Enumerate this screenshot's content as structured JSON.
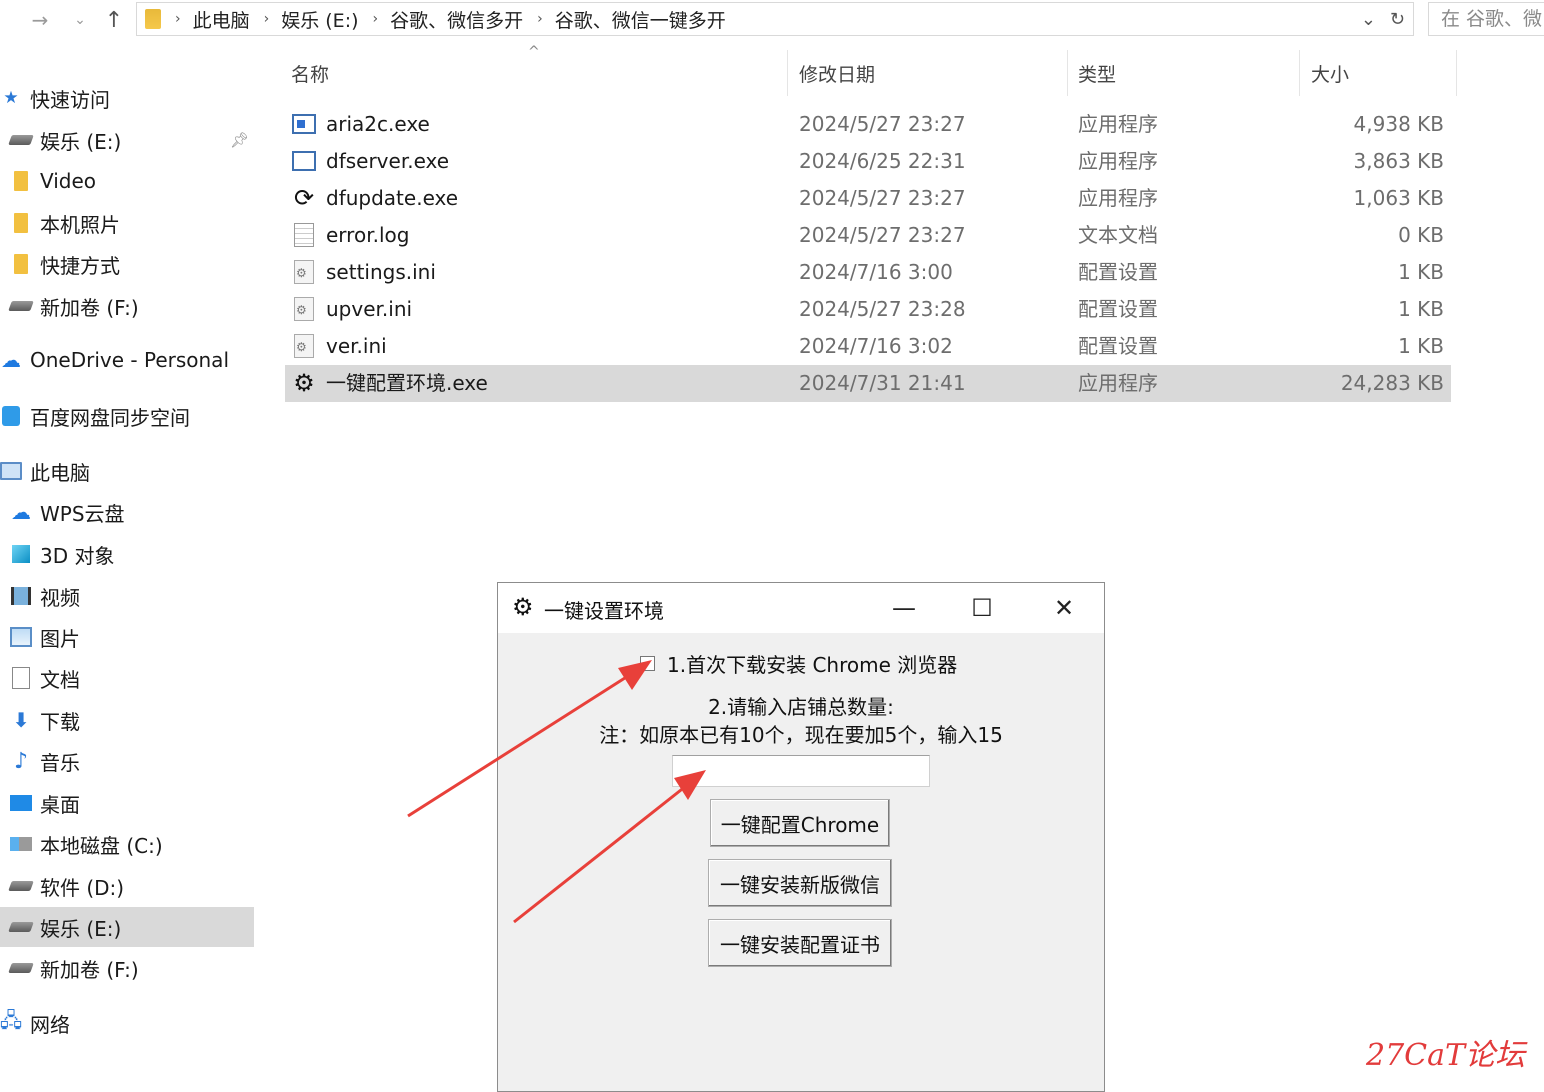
{
  "addressbar": {
    "crumbs": [
      "此电脑",
      "娱乐 (E:)",
      "谷歌、微信多开",
      "谷歌、微信一键多开"
    ],
    "search_placeholder": "在 谷歌、微"
  },
  "sidebar": {
    "items": [
      {
        "label": "快速访问",
        "icon": "star-icon"
      },
      {
        "label": "娱乐 (E:)",
        "icon": "drive-icon"
      },
      {
        "label": "Video",
        "icon": "folder-icon"
      },
      {
        "label": "本机照片",
        "icon": "folder-icon"
      },
      {
        "label": "快捷方式",
        "icon": "folder-icon"
      },
      {
        "label": "新加卷 (F:)",
        "icon": "drive-icon"
      },
      {
        "label": "OneDrive - Personal",
        "icon": "cloud-icon"
      },
      {
        "label": "百度网盘同步空间",
        "icon": "baidu-icon"
      },
      {
        "label": "此电脑",
        "icon": "pc-icon"
      },
      {
        "label": "WPS云盘",
        "icon": "cloud-icon"
      },
      {
        "label": "3D 对象",
        "icon": "cube-icon"
      },
      {
        "label": "视频",
        "icon": "film-icon"
      },
      {
        "label": "图片",
        "icon": "picture-icon"
      },
      {
        "label": "文档",
        "icon": "document-icon"
      },
      {
        "label": "下载",
        "icon": "download-icon"
      },
      {
        "label": "音乐",
        "icon": "music-icon"
      },
      {
        "label": "桌面",
        "icon": "desktop-icon"
      },
      {
        "label": "本地磁盘 (C:)",
        "icon": "windows-drive-icon"
      },
      {
        "label": "软件 (D:)",
        "icon": "drive-icon"
      },
      {
        "label": "娱乐 (E:)",
        "icon": "drive-icon"
      },
      {
        "label": "新加卷 (F:)",
        "icon": "drive-icon"
      },
      {
        "label": "网络",
        "icon": "network-icon"
      }
    ]
  },
  "filelist": {
    "columns": [
      "名称",
      "修改日期",
      "类型",
      "大小"
    ],
    "rows": [
      {
        "name": "aria2c.exe",
        "date": "2024/5/27 23:27",
        "type": "应用程序",
        "size": "4,938 KB",
        "icon": "exe-icon"
      },
      {
        "name": "dfserver.exe",
        "date": "2024/6/25 22:31",
        "type": "应用程序",
        "size": "3,863 KB",
        "icon": "window-icon"
      },
      {
        "name": "dfupdate.exe",
        "date": "2024/5/27 23:27",
        "type": "应用程序",
        "size": "1,063 KB",
        "icon": "refresh-icon"
      },
      {
        "name": "error.log",
        "date": "2024/5/27 23:27",
        "type": "文本文档",
        "size": "0 KB",
        "icon": "text-file-icon"
      },
      {
        "name": "settings.ini",
        "date": "2024/7/16 3:00",
        "type": "配置设置",
        "size": "1 KB",
        "icon": "ini-file-icon"
      },
      {
        "name": "upver.ini",
        "date": "2024/5/27 23:28",
        "type": "配置设置",
        "size": "1 KB",
        "icon": "ini-file-icon"
      },
      {
        "name": "ver.ini",
        "date": "2024/7/16 3:02",
        "type": "配置设置",
        "size": "1 KB",
        "icon": "ini-file-icon"
      },
      {
        "name": "一键配置环境.exe",
        "date": "2024/7/31 21:41",
        "type": "应用程序",
        "size": "24,283 KB",
        "icon": "gear-icon"
      }
    ]
  },
  "dialog": {
    "title": "一键设置环境",
    "checkbox_label": "1.首次下载安装 Chrome 浏览器",
    "label1": "2.请输入店铺总数量:",
    "label2": "注：如原本已有10个，现在要加5个，输入15",
    "input_value": "",
    "btn_chrome": "一键配置Chrome",
    "btn_wechat": "一键安装新版微信",
    "btn_cert": "一键安装配置证书"
  },
  "watermark": "27CaT论坛",
  "colors": {
    "arrow": "#e8403a",
    "selection": "#d9d9d9",
    "dialog_bg": "#f0f0f0"
  }
}
